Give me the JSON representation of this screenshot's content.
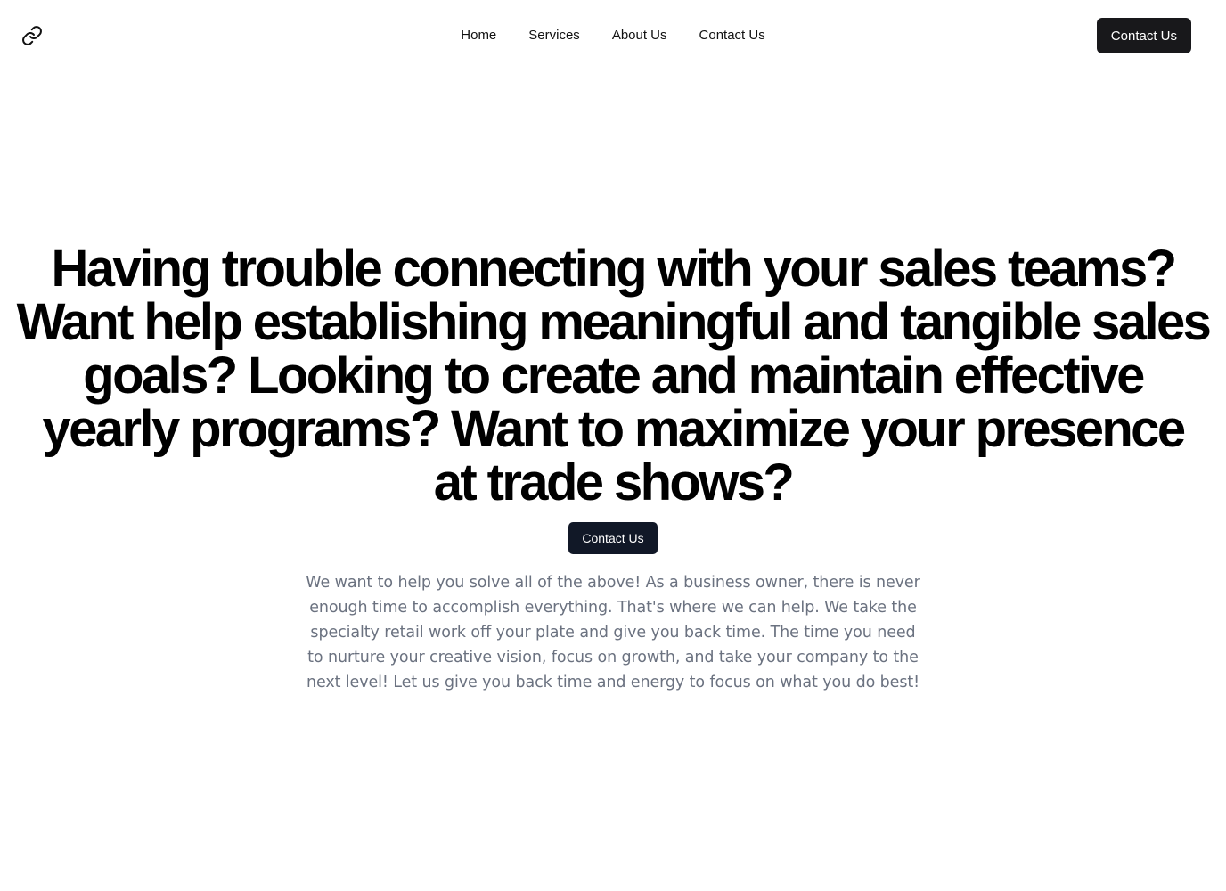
{
  "header": {
    "logo_icon": "link-icon",
    "nav": [
      {
        "label": "Home"
      },
      {
        "label": "Services"
      },
      {
        "label": "About Us"
      },
      {
        "label": "Contact Us"
      }
    ],
    "cta_label": "Contact Us"
  },
  "hero": {
    "title": "Having trouble connecting with your sales teams? Want help establishing meaningful and tangible sales goals? Looking to create and maintain effective yearly programs? Want to maximize your presence at trade shows?",
    "cta_label": "Contact Us",
    "description": "We want to help you solve all of the above! As a business owner, there is never enough time to accomplish everything. That's where we can help. We take the specialty retail work off your plate and give you back time. The time you need to nurture your creative vision, focus on growth, and take your company to the next level! Let us give you back time and energy to focus on what you do best!"
  },
  "colors": {
    "button_dark": "#18181b",
    "hero_button": "#111827",
    "muted_text": "#6b7280"
  }
}
